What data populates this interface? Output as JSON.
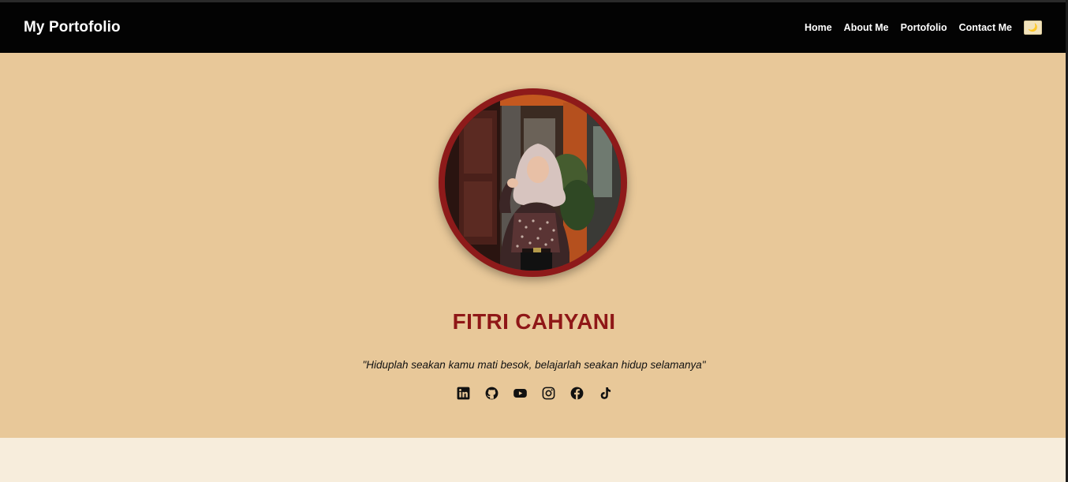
{
  "nav": {
    "brand": "My Portofolio",
    "links": [
      {
        "label": "Home"
      },
      {
        "label": "About Me"
      },
      {
        "label": "Portofolio"
      },
      {
        "label": "Contact Me"
      }
    ],
    "theme_toggle_icon": "moon-icon",
    "theme_toggle_glyph": "🌙"
  },
  "hero": {
    "name": "FITRI CAHYANI",
    "quote": "\"Hiduplah seakan kamu mati besok, belajarlah seakan hidup selamanya\"",
    "socials": [
      "linkedin-icon",
      "github-icon",
      "youtube-icon",
      "instagram-icon",
      "facebook-icon",
      "tiktok-icon"
    ]
  },
  "colors": {
    "nav_bg": "#030303",
    "hero_bg": "#e8c899",
    "accent": "#8f1717",
    "page_bg": "#f7eddc"
  }
}
